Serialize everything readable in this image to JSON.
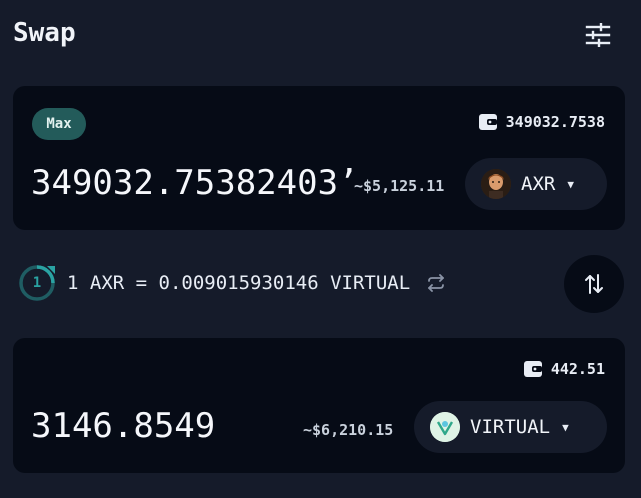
{
  "header": {
    "title": "Swap",
    "settings_icon": "sliders-icon"
  },
  "from": {
    "max_label": "Max",
    "balance": "349032.7538",
    "amount": "349032.75382403’",
    "usd_value": "~$5,125.11",
    "token_symbol": "AXR",
    "wallet_icon": "wallet-icon"
  },
  "rate": {
    "refresh_countdown": "1",
    "text": "1 AXR = 0.009015930146 VIRTUAL"
  },
  "to": {
    "balance": "442.51",
    "amount": "3146.8549",
    "usd_value": "~$6,210.15",
    "token_symbol": "VIRTUAL",
    "wallet_icon": "wallet-icon"
  },
  "colors": {
    "background": "#151b2a",
    "card": "#060b16",
    "accent": "#2aa3a3",
    "max_button": "#235b5a"
  }
}
